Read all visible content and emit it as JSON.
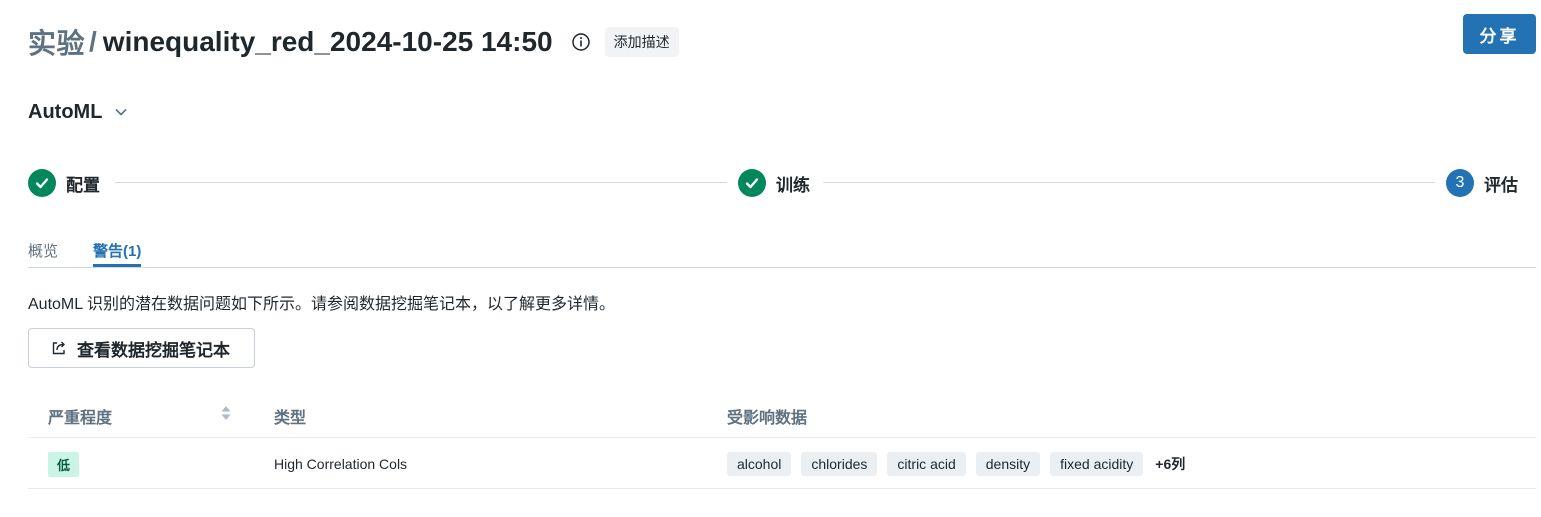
{
  "header": {
    "prefix": "实验",
    "separator": "/",
    "experiment_name": "winequality_red_2024-10-25 14:50",
    "add_description": "添加描述",
    "share_label": "分享",
    "info_icon": "info-circle-icon"
  },
  "mode_selector": {
    "value": "AutoML"
  },
  "steps": [
    {
      "label": "配置",
      "state": "done"
    },
    {
      "label": "训练",
      "state": "done"
    },
    {
      "label": "评估",
      "state": "active",
      "number": "3"
    }
  ],
  "tabs": [
    {
      "label": "概览",
      "active": false
    },
    {
      "label": "警告(1)",
      "active": true
    }
  ],
  "description": "AutoML 识别的潜在数据问题如下所示。请参阅数据挖掘笔记本，以了解更多详情。",
  "notebook_button": {
    "label": "查看数据挖掘笔记本",
    "icon": "external-link-icon"
  },
  "table": {
    "columns": [
      "严重程度",
      "类型",
      "受影响数据"
    ],
    "rows": [
      {
        "severity": "低",
        "type": "High Correlation Cols",
        "affected": [
          "alcohol",
          "chlorides",
          "citric acid",
          "density",
          "fixed acidity"
        ],
        "more": "+6列"
      }
    ]
  },
  "colors": {
    "primary": "#2272b4",
    "success": "#00875c",
    "badge_low_bg": "#c9f4e6"
  }
}
